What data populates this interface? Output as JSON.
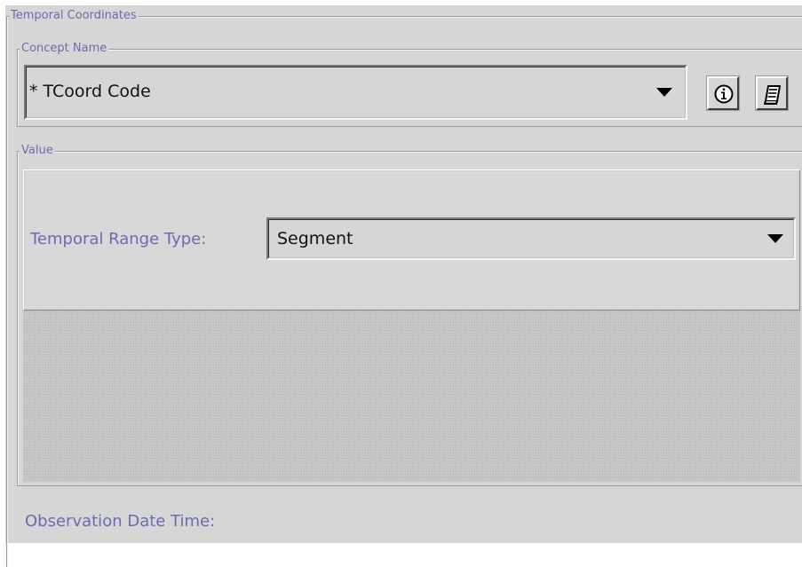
{
  "temporal_coordinates": {
    "title": "Temporal Coordinates"
  },
  "concept_name": {
    "title": "Concept Name",
    "selected_value": "* TCoord Code",
    "info_button_icon": "info-icon",
    "note_button_icon": "notepad-icon"
  },
  "value": {
    "title": "Value",
    "range_type_label": "Temporal Range Type:",
    "range_type_selected": "Segment"
  },
  "observation": {
    "label": "Observation Date Time:"
  },
  "colors": {
    "label_text": "#6b6bb0",
    "panel_background": "#d6d6d6"
  }
}
